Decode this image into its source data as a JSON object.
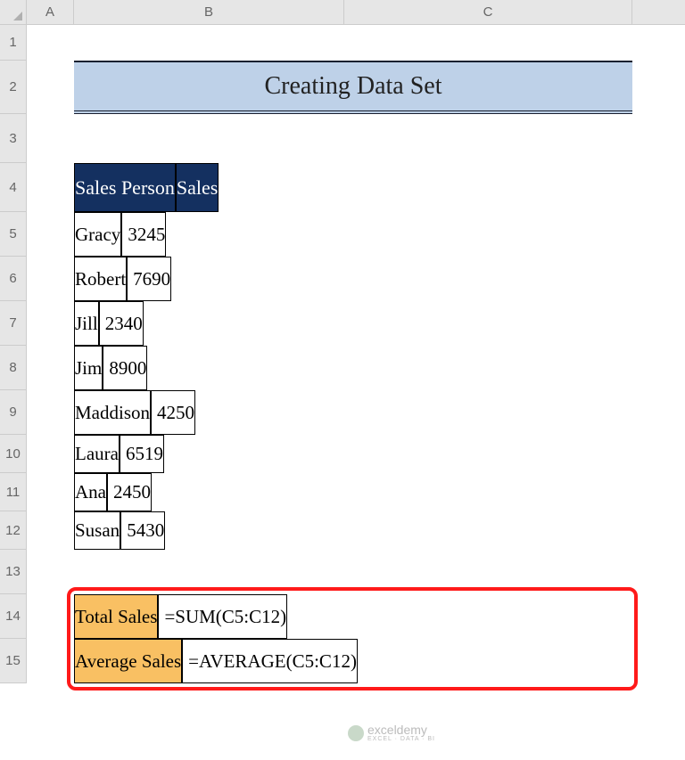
{
  "columns": {
    "A": "A",
    "B": "B",
    "C": "C"
  },
  "rows": [
    "1",
    "2",
    "3",
    "4",
    "5",
    "6",
    "7",
    "8",
    "9",
    "10",
    "11",
    "12",
    "13",
    "14",
    "15"
  ],
  "title": "Creating Data Set",
  "headers": {
    "b": "Sales Person",
    "c": "Sales"
  },
  "data": [
    {
      "person": "Gracy",
      "sales": "3245"
    },
    {
      "person": "Robert",
      "sales": "7690"
    },
    {
      "person": "Jill",
      "sales": "2340"
    },
    {
      "person": "Jim",
      "sales": "8900"
    },
    {
      "person": "Maddison",
      "sales": "4250"
    },
    {
      "person": "Laura",
      "sales": "6519"
    },
    {
      "person": "Ana",
      "sales": "2450"
    },
    {
      "person": "Susan",
      "sales": "5430"
    }
  ],
  "summary": [
    {
      "label": "Total Sales",
      "value": "=SUM(C5:C12)"
    },
    {
      "label": "Average Sales",
      "value": "=AVERAGE(C5:C12)"
    }
  ],
  "watermark": {
    "brand": "exceldemy",
    "sub": "EXCEL · DATA · BI"
  },
  "chart_data": {
    "type": "table",
    "title": "Creating Data Set",
    "columns": [
      "Sales Person",
      "Sales"
    ],
    "rows": [
      [
        "Gracy",
        3245
      ],
      [
        "Robert",
        7690
      ],
      [
        "Jill",
        2340
      ],
      [
        "Jim",
        8900
      ],
      [
        "Maddison",
        4250
      ],
      [
        "Laura",
        6519
      ],
      [
        "Ana",
        2450
      ],
      [
        "Susan",
        5430
      ]
    ],
    "summary": [
      {
        "label": "Total Sales",
        "formula": "=SUM(C5:C12)"
      },
      {
        "label": "Average Sales",
        "formula": "=AVERAGE(C5:C12)"
      }
    ]
  }
}
